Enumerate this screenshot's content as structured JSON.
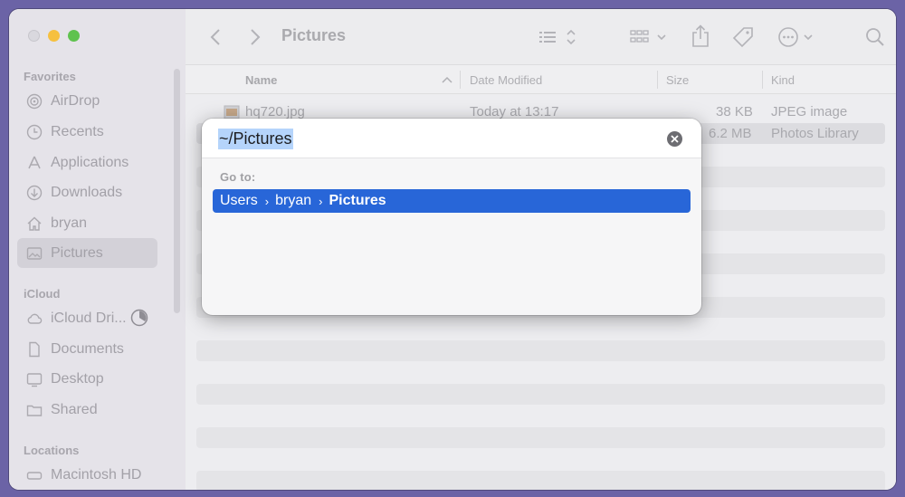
{
  "window": {
    "title": "Pictures"
  },
  "sidebar": {
    "favorites_label": "Favorites",
    "favorites": [
      {
        "label": "AirDrop",
        "icon": "airdrop-icon"
      },
      {
        "label": "Recents",
        "icon": "clock-icon"
      },
      {
        "label": "Applications",
        "icon": "applications-icon"
      },
      {
        "label": "Downloads",
        "icon": "download-icon"
      },
      {
        "label": "bryan",
        "icon": "home-icon"
      },
      {
        "label": "Pictures",
        "icon": "pictures-icon",
        "selected": true
      }
    ],
    "icloud_label": "iCloud",
    "icloud": [
      {
        "label": "iCloud Dri...",
        "icon": "cloud-icon"
      },
      {
        "label": "Documents",
        "icon": "document-icon"
      },
      {
        "label": "Desktop",
        "icon": "desktop-icon"
      },
      {
        "label": "Shared",
        "icon": "shared-folder-icon"
      }
    ],
    "locations_label": "Locations",
    "locations": [
      {
        "label": "Macintosh HD",
        "icon": "disk-icon"
      }
    ]
  },
  "columns": {
    "name": "Name",
    "date": "Date Modified",
    "size": "Size",
    "kind": "Kind"
  },
  "files": [
    {
      "name": "hq720.jpg",
      "date": "Today at 13:17",
      "size": "38 KB",
      "kind": "JPEG image"
    },
    {
      "name": "",
      "date": "",
      "size": "6.2 MB",
      "kind": "Photos Library"
    }
  ],
  "goto_dialog": {
    "path_value": "~/Pictures",
    "goto_label": "Go to:",
    "suggestion": [
      "Users",
      "bryan",
      "Pictures"
    ]
  },
  "colors": {
    "accent": "#2866d8",
    "selection": "#b5d4fb",
    "backdrop": "#6b63a6"
  }
}
